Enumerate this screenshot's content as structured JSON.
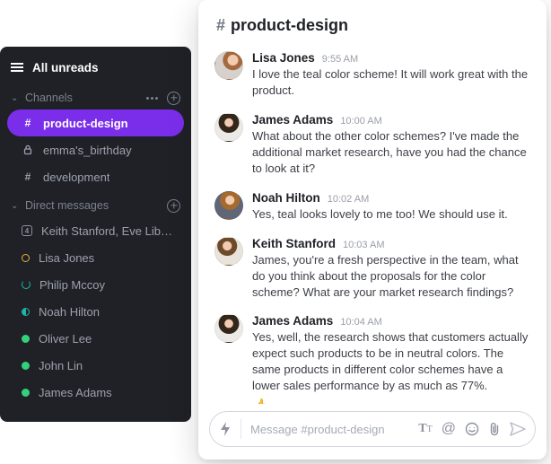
{
  "sidebar": {
    "all_unreads": "All unreads",
    "section_channels": "Channels",
    "section_dm": "Direct messages",
    "channels": [
      {
        "name": "product-design",
        "active": true
      },
      {
        "name": "emma's_birthday",
        "locked": true
      },
      {
        "name": "development"
      }
    ],
    "dms": [
      {
        "name": "Keith Stanford, Eve Libe...",
        "kind": "group",
        "count": "4"
      },
      {
        "name": "Lisa Jones",
        "kind": "away"
      },
      {
        "name": "Philip Mccoy",
        "kind": "refresh"
      },
      {
        "name": "Noah Hilton",
        "kind": "dnd"
      },
      {
        "name": "Oliver Lee",
        "kind": "online"
      },
      {
        "name": "John Lin",
        "kind": "online"
      },
      {
        "name": "James Adams",
        "kind": "online"
      }
    ]
  },
  "chat": {
    "channel_name": "product-design",
    "composer_placeholder": "Message #product-design",
    "messages": [
      {
        "author": "Lisa Jones",
        "time": "9:55 AM",
        "avatar": "av1",
        "text": "I love the teal color scheme! It will work great with the product."
      },
      {
        "author": "James Adams",
        "time": "10:00 AM",
        "avatar": "av2",
        "text": "What about the other color schemes? I've made the additional market research, have you had the chance to look at it?"
      },
      {
        "author": "Noah Hilton",
        "time": "10:02 AM",
        "avatar": "av3",
        "text": "Yes, teal looks lovely to me too! We should use it."
      },
      {
        "author": "Keith Stanford",
        "time": "10:03 AM",
        "avatar": "av4",
        "text": "James, you're a fresh perspective in the team, what do you think about the proposals for the color scheme? What are your market research findings?"
      },
      {
        "author": "James Adams",
        "time": "10:04 AM",
        "avatar": "av2",
        "text": "Yes, well, the research shows that customers actually expect such products to be in neutral colors. The same products in different color schemes have a lower sales performance by as much as 77%.",
        "reaction": "👍"
      }
    ]
  }
}
